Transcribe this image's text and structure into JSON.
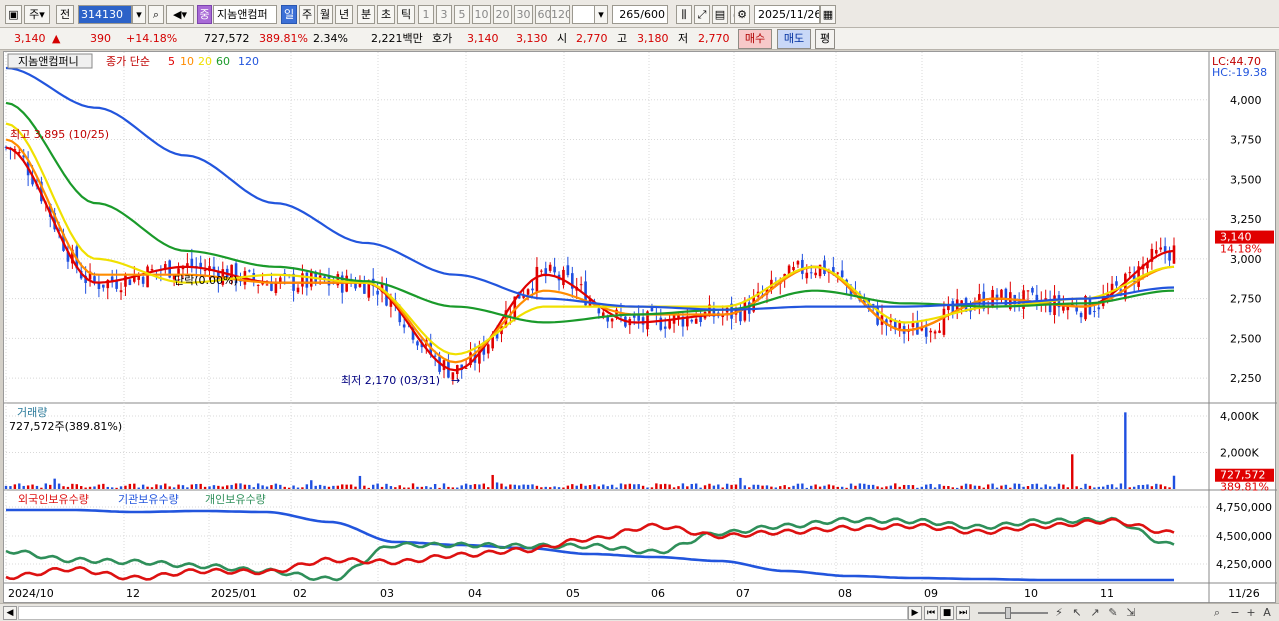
{
  "toolbar": {
    "period_short": "주",
    "prev": "전",
    "code": "314130",
    "sector_badge": "중",
    "stock_name": "지놈앤컴퍼",
    "periods": [
      "일",
      "주",
      "월",
      "년",
      "분",
      "초",
      "틱"
    ],
    "active_period": "일",
    "intervals": [
      "1",
      "3",
      "5",
      "10",
      "20",
      "30",
      "60",
      "120"
    ],
    "count": "265",
    "count_total": "/600",
    "date": "2025/11/26"
  },
  "quote": {
    "price": "3,140",
    "change_arrow": "▲",
    "change": "390",
    "change_pct": "+14.18%",
    "volume": "727,572",
    "volume_ratio": "389.81%",
    "turnover": "2.34%",
    "amount": "2,221백만",
    "hoga_label": "호가",
    "ask": "3,140",
    "bid": "3,130",
    "open_label": "시",
    "open": "2,770",
    "high_label": "고",
    "high": "3,180",
    "low_label": "저",
    "low": "2,770",
    "buy": "매수",
    "sell": "매도",
    "avg": "평"
  },
  "chart": {
    "legend_name": "지놈앤컴퍼니",
    "legend_series": "종가 단순",
    "ma_labels": [
      "5",
      "10",
      "20",
      "60",
      "120"
    ],
    "lc": "LC:44.70",
    "hc": "HC:-19.38",
    "high_note": "최고 3,895 (10/25)",
    "low_note": "최저 2,170 (03/31)",
    "flat_note": "단락(0.00%)",
    "price_axis": [
      "4,000",
      "3,750",
      "3,500",
      "3,250",
      "3,000",
      "2,750",
      "2,500",
      "2,250"
    ],
    "last_price": "3,140",
    "last_pct": "14.18%",
    "volume_title": "거래량",
    "volume_value": "727,572주(389.81%)",
    "volume_axis": [
      "4,000K",
      "2,000K"
    ],
    "volume_last": "727,572",
    "volume_last_pct": "389.81%",
    "holdings_series": [
      "외국인보유수량",
      "기관보유수량",
      "개인보유수량"
    ],
    "holdings_axis": [
      "4,750,000",
      "4,500,000",
      "4,250,000"
    ],
    "date_axis": [
      "2024/10",
      "12",
      "2025/01",
      "02",
      "03",
      "04",
      "05",
      "06",
      "07",
      "08",
      "09",
      "10",
      "11",
      "11/26"
    ],
    "colors": {
      "ma5": "#e00000",
      "ma10": "#ff8c00",
      "ma20": "#f0e000",
      "ma60": "#1a9a2a",
      "ma120": "#2255dd",
      "up": "#e00000",
      "down": "#1f4fe0",
      "foreign": "#dd1111",
      "inst": "#2255dd",
      "retail": "#2f8f5a"
    }
  },
  "chart_data": {
    "type": "line",
    "title": "지놈앤컴퍼니",
    "x": [
      "2024/10",
      "12",
      "2025/01",
      "02",
      "03",
      "04",
      "05",
      "06",
      "07",
      "08",
      "09",
      "10",
      "11",
      "11/26"
    ],
    "ylim": [
      2100,
      4250
    ],
    "series": [
      {
        "name": "5",
        "values": [
          3700,
          2850,
          2950,
          2850,
          2850,
          2300,
          2900,
          2600,
          2650,
          2950,
          2550,
          2750,
          2700,
          3050
        ]
      },
      {
        "name": "10",
        "values": [
          3750,
          2900,
          2900,
          2850,
          2850,
          2350,
          2800,
          2650,
          2650,
          2950,
          2550,
          2750,
          2700,
          2950
        ]
      },
      {
        "name": "20",
        "values": [
          3850,
          3000,
          2850,
          2900,
          2850,
          2400,
          2700,
          2700,
          2700,
          2950,
          2600,
          2700,
          2750,
          2950
        ]
      },
      {
        "name": "60",
        "values": [
          3980,
          3350,
          3050,
          2950,
          2860,
          2700,
          2600,
          2650,
          2680,
          2800,
          2720,
          2700,
          2720,
          2800
        ]
      },
      {
        "name": "120",
        "values": [
          4200,
          3950,
          3650,
          3350,
          3100,
          2900,
          2750,
          2700,
          2680,
          2700,
          2700,
          2720,
          2750,
          2820
        ]
      }
    ],
    "volume_axis": [
      0,
      4000000
    ],
    "last_volume": 727572
  },
  "scrollbar": {
    "tools": [
      "⚡",
      "↖",
      "↗",
      "✎",
      "⇲",
      "⌕",
      "−",
      "+",
      "A"
    ]
  }
}
